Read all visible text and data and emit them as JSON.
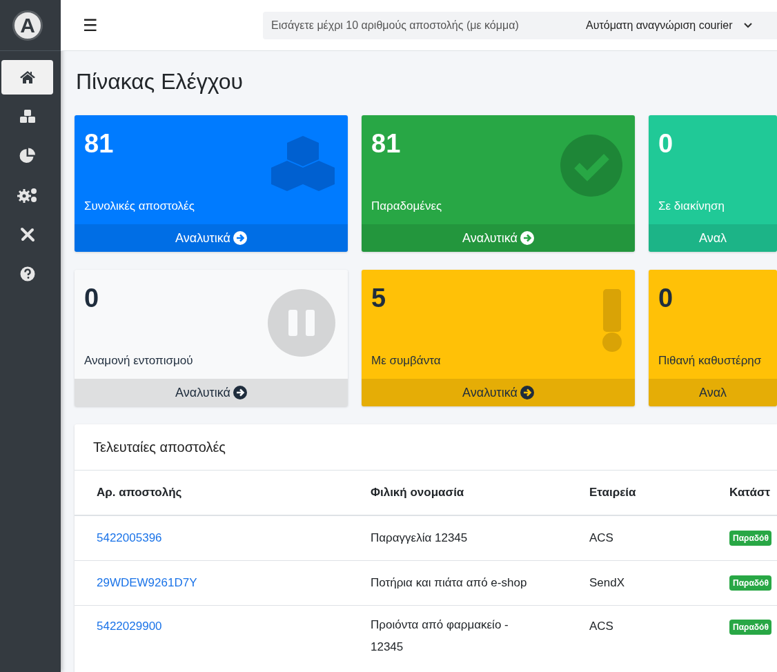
{
  "logo": {
    "letter": "A"
  },
  "sidebar": {
    "items": [
      {
        "kind": "home",
        "selected": true
      },
      {
        "kind": "shipments",
        "selected": false
      },
      {
        "kind": "reports",
        "selected": false
      },
      {
        "kind": "settings",
        "selected": false
      },
      {
        "kind": "tools",
        "selected": false
      },
      {
        "kind": "help",
        "selected": false
      }
    ]
  },
  "header": {
    "menu_glyph": "☰",
    "search": {
      "placeholder": "Εισάγετε μέχρι 10 αριθμούς αποστολής (με κόμμα)"
    },
    "courier_select": {
      "value": "Αυτόματη αναγνώριση courier"
    }
  },
  "page_title": "Πίνακας Ελέγχου",
  "cards": [
    {
      "count": "81",
      "label": "Συνολικές αποστολές",
      "footer": "Αναλυτικά",
      "kind": "total"
    },
    {
      "count": "81",
      "label": "Παραδομένες",
      "footer": "Αναλυτικά",
      "kind": "delivered"
    },
    {
      "count": "0",
      "label": "Σε διακίνηση",
      "footer": "Αναλ",
      "kind": "transit"
    },
    {
      "count": "0",
      "label": "Αναμονή εντοπισμού",
      "footer": "Αναλυτικά",
      "kind": "waiting"
    },
    {
      "count": "5",
      "label": "Με συμβάντα",
      "footer": "Αναλυτικά",
      "kind": "incidents"
    },
    {
      "count": "0",
      "label": "Πιθανή καθυστέρησ",
      "footer": "Αναλ",
      "kind": "delay"
    }
  ],
  "recent": {
    "title": "Τελευταίες αποστολές",
    "columns": [
      "Αρ. αποστολής",
      "Φιλική ονομασία",
      "Εταιρεία",
      "Κατάστ"
    ],
    "rows": [
      {
        "tracking": "5422005396",
        "name": "Παραγγελία 12345",
        "company": "ACS",
        "status": "Παραδόθ"
      },
      {
        "tracking": "29WDEW9261D7Y",
        "name": "Ποτήρια και πιάτα από e-shop",
        "company": "SendX",
        "status": "Παραδόθ"
      },
      {
        "tracking": "5422029900",
        "name": "Προιόντα από φαρμακείο - 12345",
        "company": "ACS",
        "status": "Παραδόθ"
      }
    ]
  }
}
